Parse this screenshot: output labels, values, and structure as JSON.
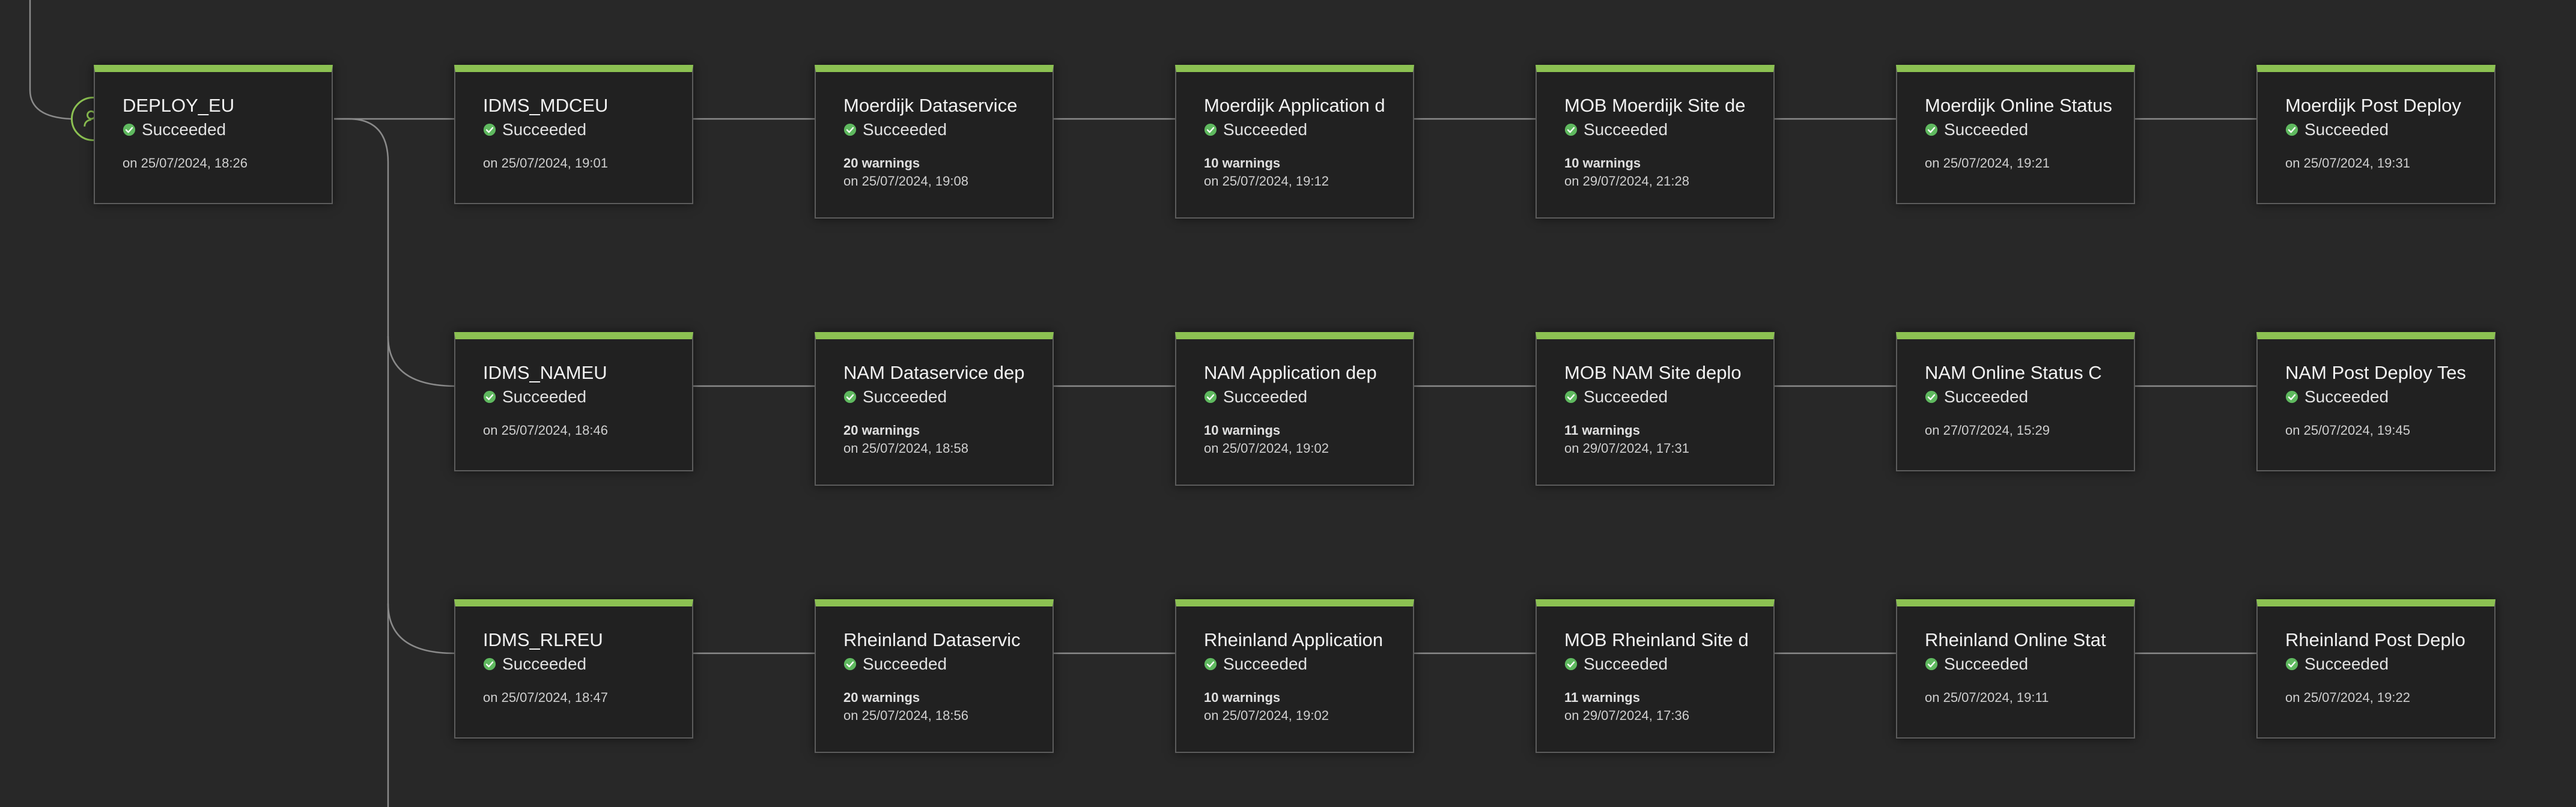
{
  "pipeline": {
    "trigger_icon": "user-trigger-icon",
    "accent_color": "#8cc152",
    "success_color": "#5fb95f",
    "stages": [
      {
        "name": "DEPLOY_EU",
        "status": "Succeeded",
        "warnings": "",
        "completed": "on 25/07/2024, 18:26"
      },
      {
        "name": "IDMS_MDCEU",
        "status": "Succeeded",
        "warnings": "",
        "completed": "on 25/07/2024, 19:01"
      },
      {
        "name": "Moerdijk Dataservice",
        "status": "Succeeded",
        "warnings": "20 warnings",
        "completed": "on 25/07/2024, 19:08"
      },
      {
        "name": "Moerdijk Application d",
        "status": "Succeeded",
        "warnings": "10 warnings",
        "completed": "on 25/07/2024, 19:12"
      },
      {
        "name": "MOB Moerdijk Site de",
        "status": "Succeeded",
        "warnings": "10 warnings",
        "completed": "on 29/07/2024, 21:28"
      },
      {
        "name": "Moerdijk Online Status",
        "status": "Succeeded",
        "warnings": "",
        "completed": "on 25/07/2024, 19:21"
      },
      {
        "name": "Moerdijk Post Deploy",
        "status": "Succeeded",
        "warnings": "",
        "completed": "on 25/07/2024, 19:31"
      },
      {
        "name": "IDMS_NAMEU",
        "status": "Succeeded",
        "warnings": "",
        "completed": "on 25/07/2024, 18:46"
      },
      {
        "name": "NAM Dataservice dep",
        "status": "Succeeded",
        "warnings": "20 warnings",
        "completed": "on 25/07/2024, 18:58"
      },
      {
        "name": "NAM Application dep",
        "status": "Succeeded",
        "warnings": "10 warnings",
        "completed": "on 25/07/2024, 19:02"
      },
      {
        "name": "MOB NAM Site deplo",
        "status": "Succeeded",
        "warnings": "11 warnings",
        "completed": "on 29/07/2024, 17:31"
      },
      {
        "name": "NAM Online Status C",
        "status": "Succeeded",
        "warnings": "",
        "completed": "on 27/07/2024, 15:29"
      },
      {
        "name": "NAM Post Deploy Tes",
        "status": "Succeeded",
        "warnings": "",
        "completed": "on 25/07/2024, 19:45"
      },
      {
        "name": "IDMS_RLREU",
        "status": "Succeeded",
        "warnings": "",
        "completed": "on 25/07/2024, 18:47"
      },
      {
        "name": "Rheinland Dataservic",
        "status": "Succeeded",
        "warnings": "20 warnings",
        "completed": "on 25/07/2024, 18:56"
      },
      {
        "name": "Rheinland Application",
        "status": "Succeeded",
        "warnings": "10 warnings",
        "completed": "on 25/07/2024, 19:02"
      },
      {
        "name": "MOB Rheinland Site d",
        "status": "Succeeded",
        "warnings": "11 warnings",
        "completed": "on 29/07/2024, 17:36"
      },
      {
        "name": "Rheinland Online Stat",
        "status": "Succeeded",
        "warnings": "",
        "completed": "on 25/07/2024, 19:11"
      },
      {
        "name": "Rheinland Post Deplo",
        "status": "Succeeded",
        "warnings": "",
        "completed": "on 25/07/2024, 19:22"
      }
    ]
  }
}
